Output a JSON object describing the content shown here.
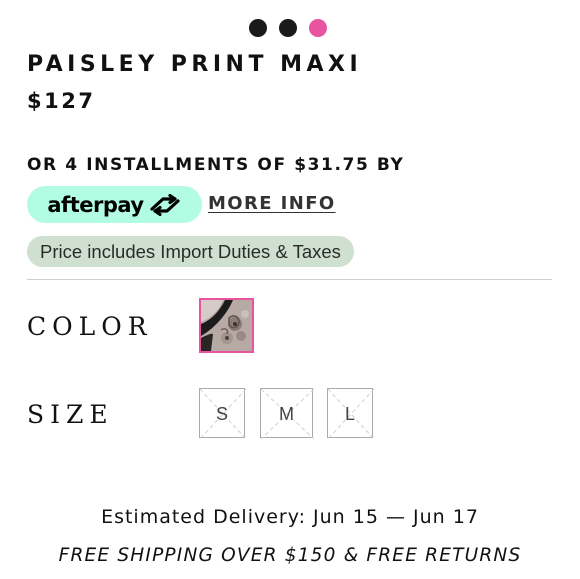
{
  "carousel": {
    "dots": [
      {
        "active": false
      },
      {
        "active": false
      },
      {
        "active": true
      }
    ],
    "active_color": "#e8549f",
    "inactive_color": "#1a1a1a"
  },
  "product": {
    "title": "PAISLEY PRINT MAXI",
    "price": "$127"
  },
  "payment": {
    "installments_text": "OR 4 INSTALLMENTS OF $31.75 BY",
    "afterpay_label": "afterpay",
    "afterpay_icon": "afterpay-arrows-icon",
    "afterpay_color": "#b2fce4",
    "more_info_label": "MORE INFO"
  },
  "duties_badge": {
    "text": "Price includes Import Duties & Taxes",
    "color": "#cfe0d0"
  },
  "options": {
    "color_label": "COLOR",
    "size_label": "SIZE",
    "selected_swatch_border": "#e8549f",
    "sizes": [
      {
        "label": "S",
        "available": false
      },
      {
        "label": "M",
        "available": false
      },
      {
        "label": "L",
        "available": false
      }
    ]
  },
  "delivery": {
    "text": "Estimated Delivery: Jun 15 — Jun 17"
  },
  "shipping": {
    "text": "FREE SHIPPING OVER $150 & FREE RETURNS"
  }
}
